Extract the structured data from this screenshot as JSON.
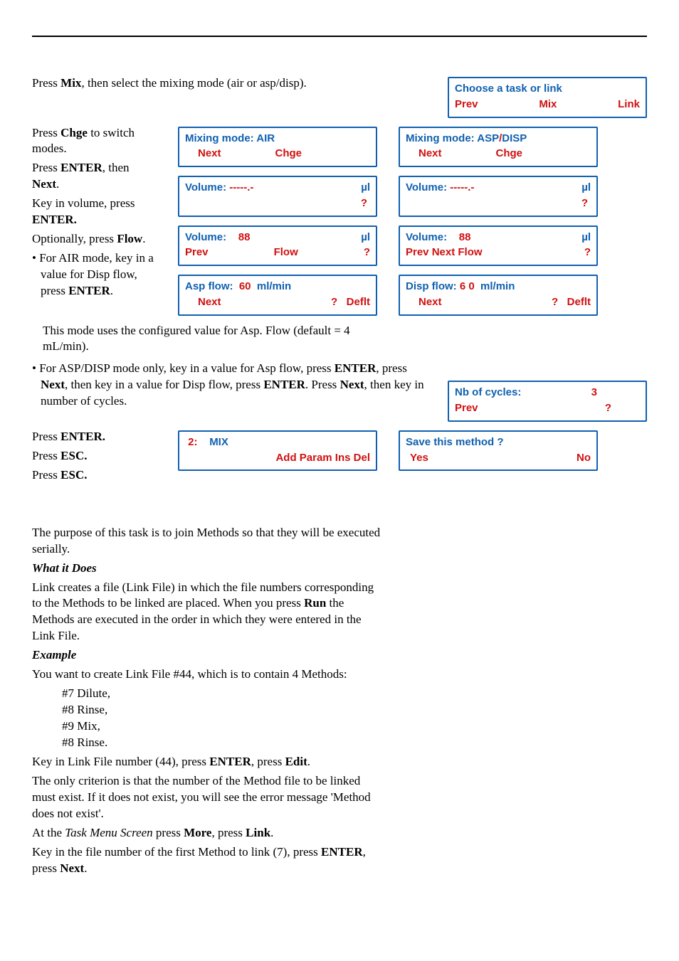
{
  "text": {
    "intro": "Press ",
    "intro2": "Mix",
    "intro3": ", then select the mixing mode (air or asp/disp).",
    "chge1": "Press ",
    "chge2": "Chge",
    "chge3": " to switch modes.",
    "entnext1": "Press ",
    "entnext2": "ENTER",
    "entnext3": ", then ",
    "entnext4": "Next",
    "entnext5": ".",
    "keyvol": "Key in volume, press ",
    "keyvol2": "ENTER.",
    "optflow1": "Optionally, press ",
    "optflow2": "Flow",
    "optflow3": ".",
    "air1": "• For AIR mode, key in a value for Disp flow, press ",
    "air2": "ENTER",
    "air3": ".",
    "airtail": "This mode uses the configured value for Asp. Flow (default = 4 mL/min).",
    "asp1": "• For ASP/DISP mode only, key in a value for Asp flow, press ",
    "asp2": "ENTER",
    "asp3": ", press ",
    "asp4": "Next",
    "asp5": ", then key in a value for Disp flow, press ",
    "asp6": "ENTER",
    "asp7": ". Press ",
    "asp8": "Next",
    "asp9": ", then key in number of cycles.",
    "pressEnter1": "Press ",
    "pressEnter2": "ENTER.",
    "pressEsc1": "Press ",
    "pressEsc2": "ESC.",
    "pressEsc3": "Press ",
    "pressEsc4": "ESC.",
    "purpose": "The purpose of this task is to join Methods so that they will be executed serially.",
    "what": "What it Does",
    "whatBody": "Link creates a file (Link File) in which the file numbers corresponding to the Methods to be linked are placed. When you press ",
    "whatBody2": "Run",
    "whatBody3": " the Methods are executed in the order in which they were entered in the Link File.",
    "example": "Example",
    "exBody": "You want to create Link File #44, which is to contain 4 Methods:",
    "m1": "#7 Dilute,",
    "m2": "#8 Rinse,",
    "m3": "#9 Mix,",
    "m4": "#8 Rinse.",
    "keylink1": "Key in Link File number (44), press ",
    "keylink2": "ENTER",
    "keylink3": ", press ",
    "keylink4": "Edit",
    "keylink5": ".",
    "crit": "The only criterion is that the number of the Method file to be linked must exist. If it does not exist, you will see the error message 'Method does not exist'.",
    "taskmenu1": "At the ",
    "taskmenu2": "Task Menu Screen",
    "taskmenu3": " press ",
    "taskmenu4": "More",
    "taskmenu5": ", press ",
    "taskmenu6": "Link",
    "taskmenu7": ".",
    "keyfirst1": "Key in the file number of the first Method to link (7), press ",
    "keyfirst2": "ENTER",
    "keyfirst3": ", press ",
    "keyfirst4": "Next",
    "keyfirst5": "."
  },
  "lcd": {
    "choose": {
      "l1": "Choose a task or link",
      "prevLbl": "Prev",
      "mixLbl": "Mix",
      "linkLbl": "Link"
    },
    "mixAir": {
      "l1": "Mixing mode: AIR",
      "nextLbl": "Next",
      "chgeLbl": "Chge"
    },
    "mixAsp": {
      "l1a": "Mixing mode: ASP",
      "slash": "/",
      "l1b": "DISP",
      "nextLbl": "Next",
      "chgeLbl": "Chge"
    },
    "volBlank1": {
      "l1a": "Volume:",
      "dashes": "-----.-",
      "unit": "µl",
      "q": "?"
    },
    "volBlank2": {
      "l1a": "Volume:",
      "dashes": "-----.-",
      "unit": "µl",
      "q": "?"
    },
    "vol88a": {
      "l1a": "Volume:",
      "val": "88",
      "unit": "µl",
      "q": "?",
      "prev": "Prev",
      "flow": "Flow"
    },
    "vol88b": {
      "l1a": "Volume:",
      "val": "88",
      "unit": "µl",
      "q": "?",
      "footer": "Prev Next Flow"
    },
    "aspflow": {
      "l1a": "Asp flow:",
      "val": "60",
      "unit": "ml/min",
      "next": "Next",
      "q": "?",
      "deflt": "Deflt"
    },
    "dispflow": {
      "l1a": "Disp flow:",
      "val": "6 0",
      "unit": "ml/min",
      "next": "Next",
      "q": "?",
      "deflt": "Deflt"
    },
    "cycles": {
      "l1a": "Nb of cycles:",
      "val": "3",
      "prev": "Prev",
      "q": "?"
    },
    "mixstep": {
      "idx": "2:",
      "name": "MIX",
      "footer": "Add Param Ins Del"
    },
    "save": {
      "l1": "Save this method ?",
      "yes": "Yes",
      "no": "No"
    }
  }
}
